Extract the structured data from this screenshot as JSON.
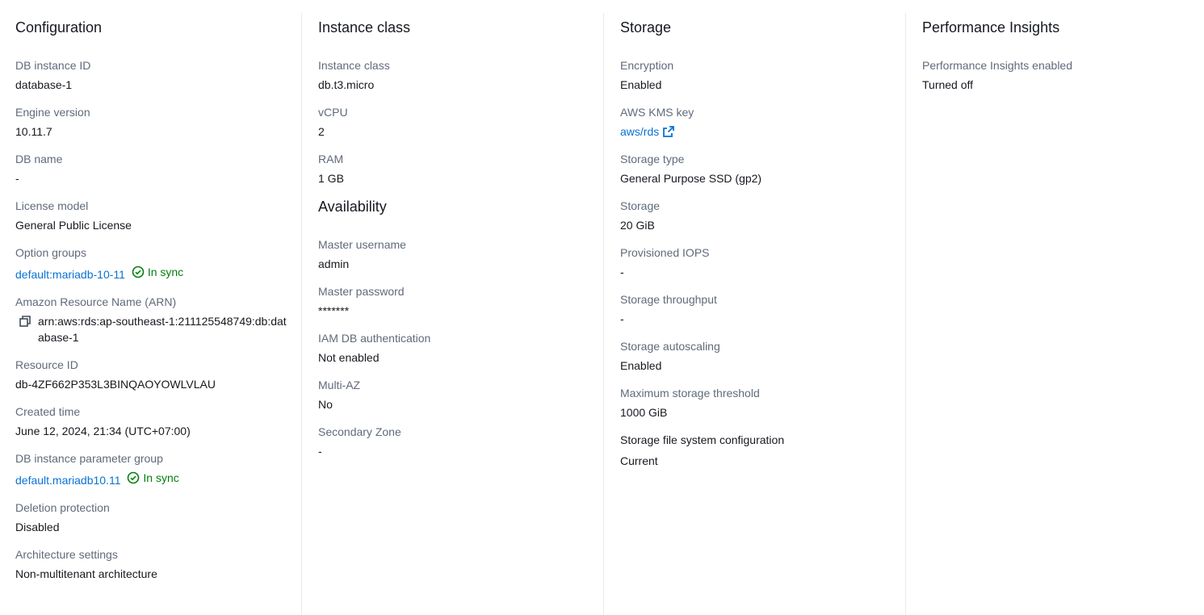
{
  "configuration": {
    "title": "Configuration",
    "db_instance_id": {
      "label": "DB instance ID",
      "value": "database-1"
    },
    "engine_version": {
      "label": "Engine version",
      "value": "10.11.7"
    },
    "db_name": {
      "label": "DB name",
      "value": "-"
    },
    "license_model": {
      "label": "License model",
      "value": "General Public License"
    },
    "option_groups": {
      "label": "Option groups",
      "link": "default:mariadb-10-11",
      "status": "In sync"
    },
    "arn": {
      "label": "Amazon Resource Name (ARN)",
      "value": "arn:aws:rds:ap-southeast-1:211125548749:db:database-1"
    },
    "resource_id": {
      "label": "Resource ID",
      "value": "db-4ZF662P353L3BINQAOYOWLVLAU"
    },
    "created_time": {
      "label": "Created time",
      "value": "June 12, 2024, 21:34 (UTC+07:00)"
    },
    "parameter_group": {
      "label": "DB instance parameter group",
      "link": "default.mariadb10.11",
      "status": "In sync"
    },
    "deletion_protection": {
      "label": "Deletion protection",
      "value": "Disabled"
    },
    "architecture": {
      "label": "Architecture settings",
      "value": "Non-multitenant architecture"
    }
  },
  "instance_class": {
    "title": "Instance class",
    "class": {
      "label": "Instance class",
      "value": "db.t3.micro"
    },
    "vcpu": {
      "label": "vCPU",
      "value": "2"
    },
    "ram": {
      "label": "RAM",
      "value": "1 GB"
    }
  },
  "availability": {
    "title": "Availability",
    "master_username": {
      "label": "Master username",
      "value": "admin"
    },
    "master_password": {
      "label": "Master password",
      "value": "*******"
    },
    "iam_auth": {
      "label": "IAM DB authentication",
      "value": "Not enabled"
    },
    "multi_az": {
      "label": "Multi-AZ",
      "value": "No"
    },
    "secondary_zone": {
      "label": "Secondary Zone",
      "value": "-"
    }
  },
  "storage": {
    "title": "Storage",
    "encryption": {
      "label": "Encryption",
      "value": "Enabled"
    },
    "kms_key": {
      "label": "AWS KMS key",
      "link": "aws/rds"
    },
    "storage_type": {
      "label": "Storage type",
      "value": "General Purpose SSD (gp2)"
    },
    "storage": {
      "label": "Storage",
      "value": "20 GiB"
    },
    "iops": {
      "label": "Provisioned IOPS",
      "value": "-"
    },
    "throughput": {
      "label": "Storage throughput",
      "value": "-"
    },
    "autoscaling": {
      "label": "Storage autoscaling",
      "value": "Enabled"
    },
    "max_threshold": {
      "label": "Maximum storage threshold",
      "value": "1000 GiB"
    },
    "file_system": {
      "label": "Storage file system configuration",
      "value": "Current"
    }
  },
  "performance_insights": {
    "title": "Performance Insights",
    "enabled": {
      "label": "Performance Insights enabled",
      "value": "Turned off"
    }
  },
  "colors": {
    "link": "#0972d3",
    "success": "#037f0c",
    "label": "#5f6b7a",
    "text": "#16191f",
    "divider": "#e9ebed"
  }
}
